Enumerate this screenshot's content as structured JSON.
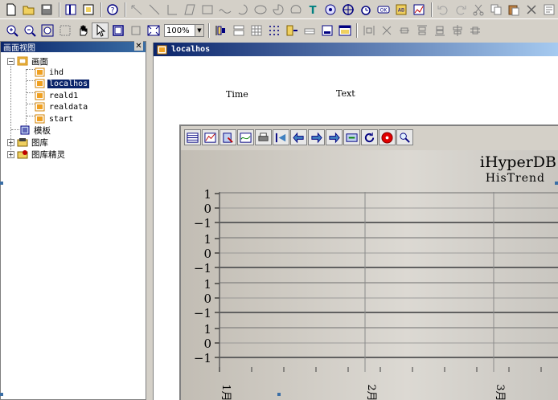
{
  "toolbar1": {
    "buttons": [
      "new-file",
      "open-folder",
      "save",
      "sep",
      "page-setup",
      "view-toggle",
      "sep",
      "help",
      "sep",
      "select-region",
      "line",
      "polyline",
      "polygon",
      "rectangle",
      "curve",
      "arc",
      "ellipse",
      "pie",
      "chord",
      "text",
      "image",
      "crosshair",
      "alarm",
      "button-ok",
      "button-ab",
      "trend",
      "sep",
      "undo",
      "redo",
      "cut",
      "copy",
      "paste",
      "delete",
      "properties"
    ]
  },
  "toolbar2": {
    "zoom_value": "100%"
  },
  "left_panel": {
    "title": "画面视图",
    "close": "✕",
    "root": "画面",
    "screens": [
      "ihd",
      "localhos",
      "reald1",
      "realdata",
      "start"
    ],
    "selected": "localhos",
    "others": [
      "模板",
      "图库",
      "图库精灵"
    ]
  },
  "document": {
    "title": "localhos",
    "label_time": "Time",
    "label_text": "Text"
  },
  "chart_data": {
    "type": "line",
    "title": "iHyperDB",
    "subtitle": "HisTrend",
    "panels": [
      {
        "ylim": [
          -1,
          1
        ],
        "yticks": [
          "1",
          "0",
          "−1"
        ]
      },
      {
        "ylim": [
          -1,
          1
        ],
        "yticks": [
          "1",
          "0",
          "−1"
        ]
      },
      {
        "ylim": [
          -1,
          1
        ],
        "yticks": [
          "1",
          "0",
          "−1"
        ]
      },
      {
        "ylim": [
          -1,
          1
        ],
        "yticks": [
          "1",
          "0",
          "−1"
        ]
      }
    ],
    "x_ticks": [
      "1月",
      "2月",
      "3月"
    ],
    "series": [],
    "grid": true
  }
}
